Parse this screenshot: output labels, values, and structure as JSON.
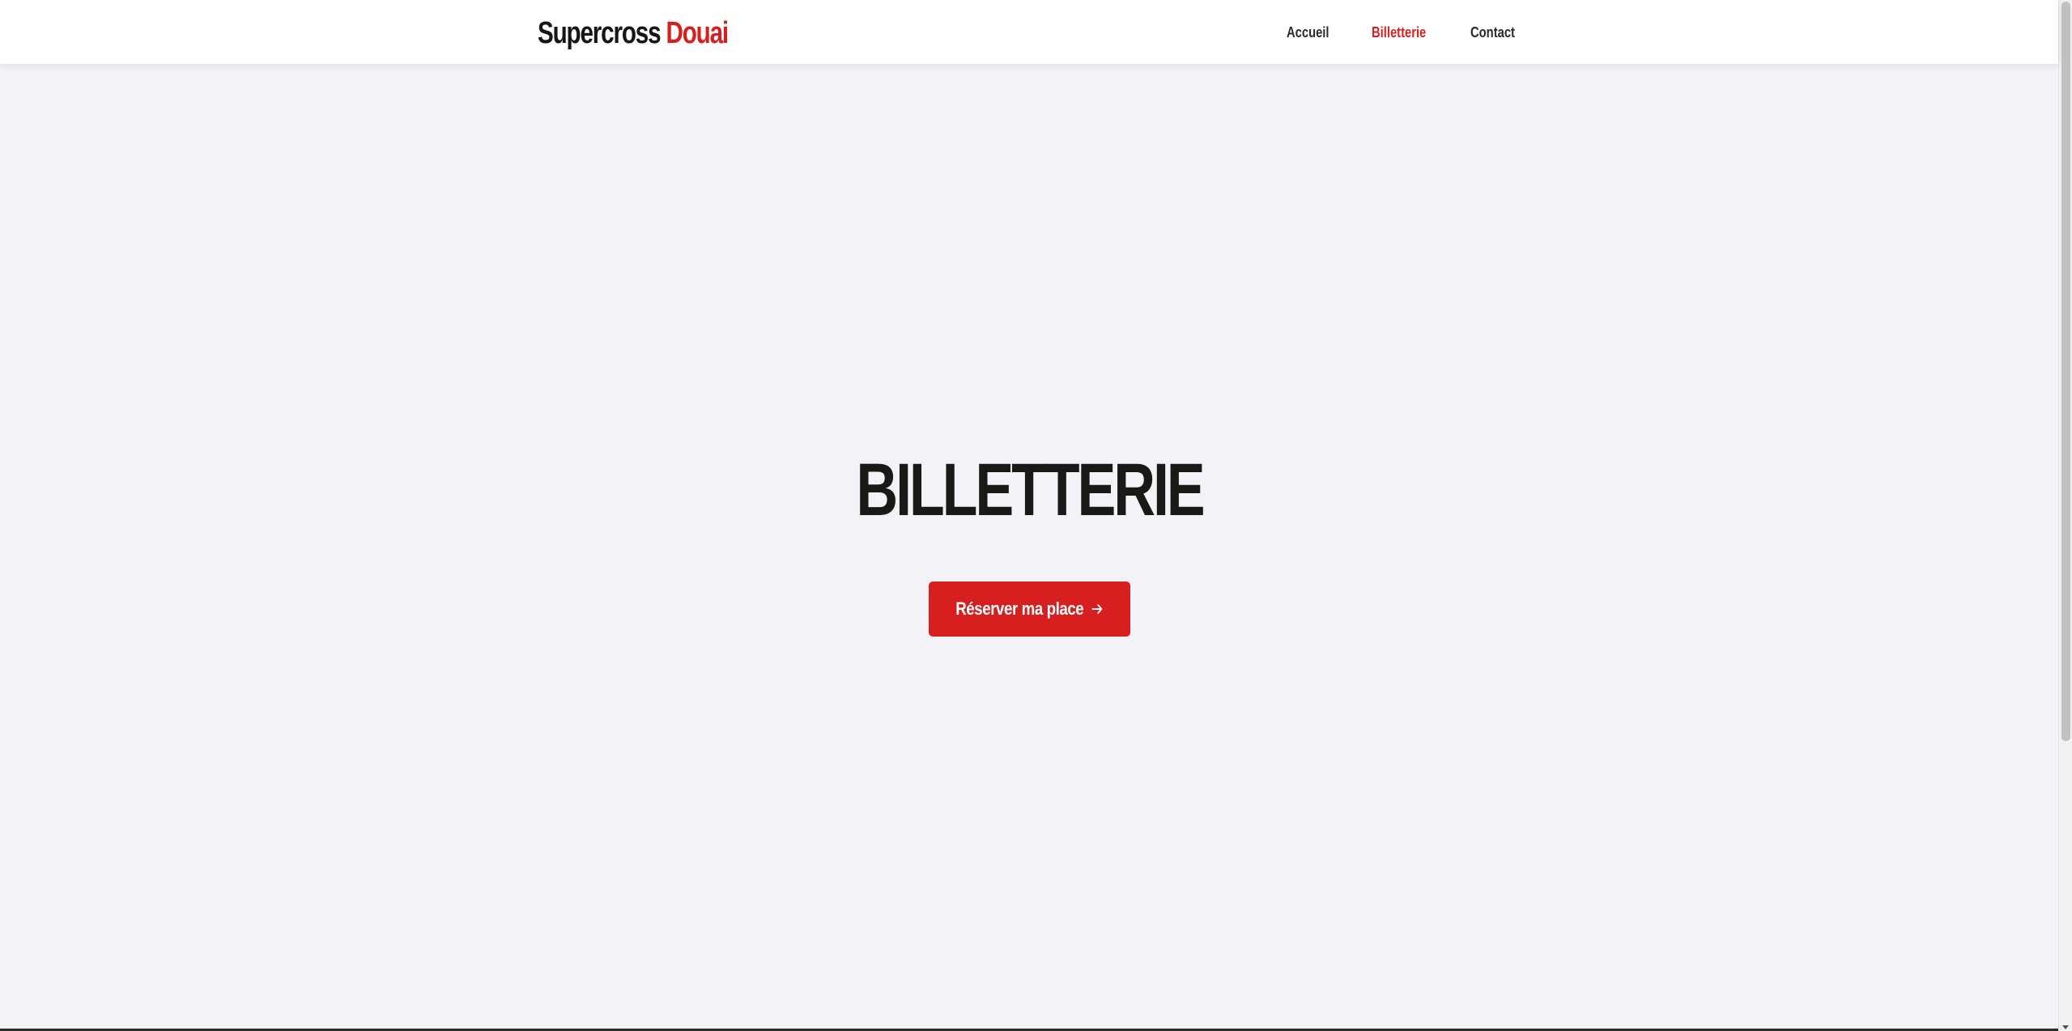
{
  "header": {
    "logo": {
      "main": "Supercross",
      "accent": "Douai"
    },
    "nav": [
      {
        "label": "Accueil",
        "active": false
      },
      {
        "label": "Billetterie",
        "active": true
      },
      {
        "label": "Contact",
        "active": false
      }
    ]
  },
  "hero": {
    "title": "BILLETTERIE",
    "cta_label": "Réserver ma place",
    "cta_icon": "arrow-right-icon"
  },
  "colors": {
    "accent": "#d71f1f",
    "page_background": "#f3f3f7",
    "header_background": "#ffffff",
    "text_dark": "#1b1818"
  }
}
